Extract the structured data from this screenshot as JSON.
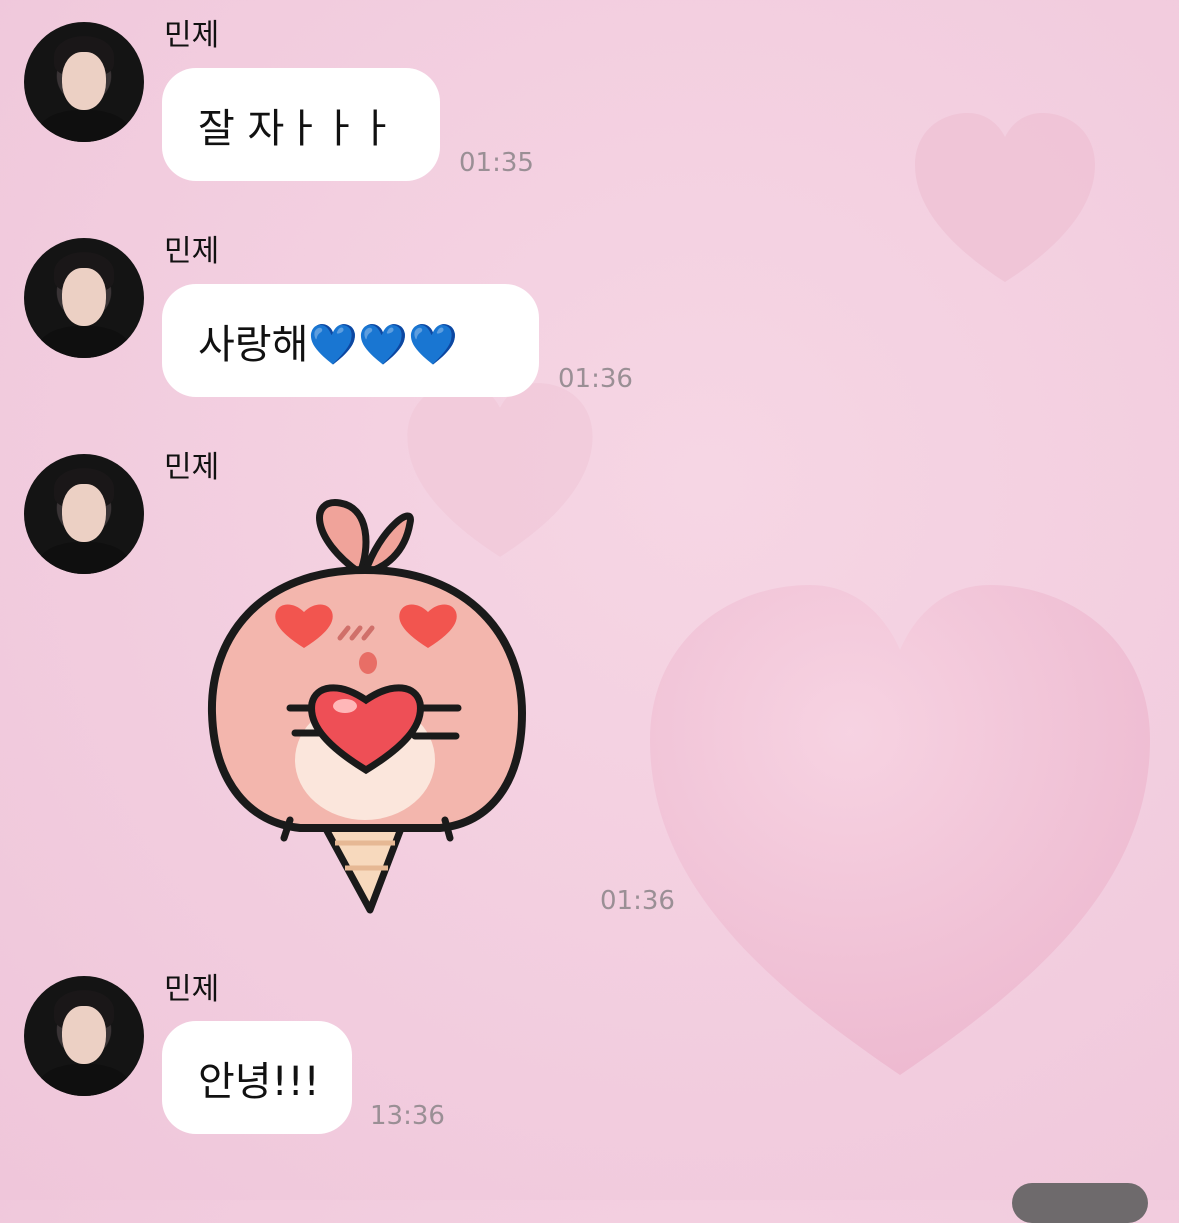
{
  "messages": [
    {
      "sender": "민제",
      "text": "잘 자ㅏㅏㅏ",
      "time": "01:35"
    },
    {
      "sender": "민제",
      "text": "사랑해💙💙💙",
      "time": "01:36"
    },
    {
      "sender": "민제",
      "sticker": "peach-ice-cream-heart-sticker",
      "time": "01:36"
    },
    {
      "sender": "민제",
      "text": "안녕!!!",
      "time": "13:36"
    }
  ],
  "colors": {
    "bubble": "#ffffff",
    "background": "#f3cfe0",
    "timestamp": "#9a8f95"
  }
}
